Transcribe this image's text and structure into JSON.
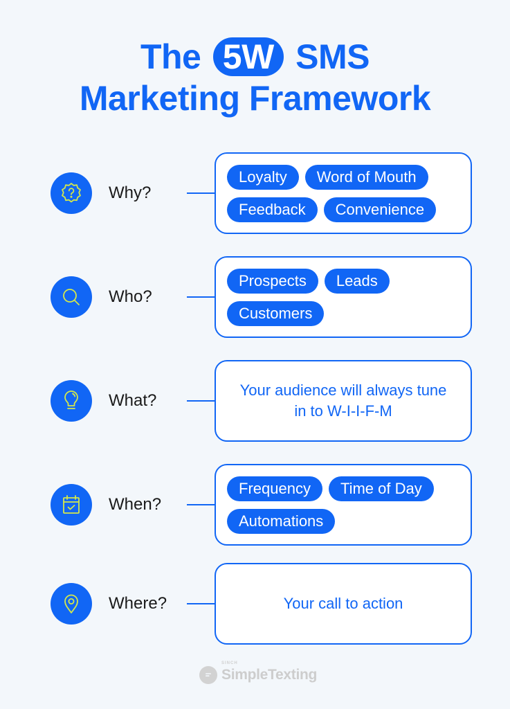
{
  "title": {
    "prefix": "The",
    "highlight": "5W",
    "suffix": "SMS",
    "line2": "Marketing Framework"
  },
  "colors": {
    "brand_blue": "#1166F5",
    "icon_stroke": "#D4E84A",
    "background": "#F3F7FB",
    "label_text": "#1a1a1a",
    "logo_gray": "#CDCDCD"
  },
  "rows": [
    {
      "icon": "question-badge-icon",
      "label": "Why?",
      "chips": [
        "Loyalty",
        "Word of Mouth",
        "Feedback",
        "Convenience"
      ]
    },
    {
      "icon": "search-icon",
      "label": "Who?",
      "chips": [
        "Prospects",
        "Leads",
        "Customers"
      ]
    },
    {
      "icon": "lightbulb-icon",
      "label": "What?",
      "text": "Your audience will always tune in to W-I-I-F-M"
    },
    {
      "icon": "calendar-check-icon",
      "label": "When?",
      "chips": [
        "Frequency",
        "Time of Day",
        "Automations"
      ]
    },
    {
      "icon": "location-pin-icon",
      "label": "Where?",
      "text": "Your call to action"
    }
  ],
  "logo": {
    "overline": "SINCH",
    "name": "SimpleTexting",
    "icon": "chat-bubble-icon"
  }
}
